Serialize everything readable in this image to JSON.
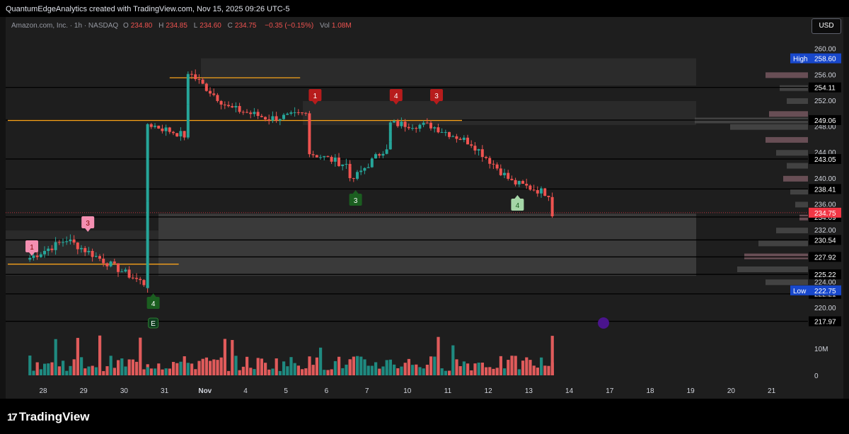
{
  "header": {
    "credit": "QuantumEdgeAnalytics created with TradingView.com, Nov 15, 2025 09:26 UTC-5"
  },
  "legend": {
    "symbol": "Amazon.com, Inc. · 1h · NASDAQ",
    "o_label": "O",
    "o_value": "234.80",
    "h_label": "H",
    "h_value": "234.85",
    "l_label": "L",
    "l_value": "234.60",
    "c_label": "C",
    "c_value": "234.75",
    "change": "−0.35 (−0.15%)",
    "vol_label": "Vol",
    "vol_value": "1.08M"
  },
  "currency_button": "USD",
  "colors": {
    "up": "#26a69a",
    "down": "#ef5350",
    "level": "#f7a21b",
    "low_label": "#1848cc",
    "price_label": "#f23645"
  },
  "badges": {
    "high_label": "High",
    "high_value": "258.60",
    "low_label": "Low",
    "low_value": "222.75",
    "last_price": "234.75"
  },
  "branding": {
    "name": "TradingView"
  },
  "chart_data": {
    "type": "candlestick",
    "y_axis": {
      "range": [
        216.5,
        261.5
      ],
      "ticks": [
        "260.00",
        "256.00",
        "252.00",
        "248.00",
        "244.00",
        "240.00",
        "236.00",
        "232.00",
        "228.00",
        "224.00",
        "220.00"
      ]
    },
    "volume_axis": {
      "ticks": [
        "10M",
        "0"
      ]
    },
    "x_axis": {
      "ticks": [
        "28",
        "29",
        "30",
        "31",
        "Nov",
        "4",
        "5",
        "6",
        "7",
        "10",
        "11",
        "12",
        "13",
        "14",
        "17",
        "18",
        "19",
        "20",
        "21"
      ]
    },
    "horizontal_levels": [
      "254.11",
      "249.06",
      "243.05",
      "238.41",
      "234.09",
      "230.54",
      "227.92",
      "225.22",
      "222.21",
      "217.97"
    ],
    "orange_levels": [
      {
        "price": 255.6,
        "from": "Nov",
        "to": "5"
      },
      {
        "price": 249.0,
        "from": "28",
        "to": "11"
      },
      {
        "price": 226.8,
        "from": "28",
        "to": "31"
      }
    ],
    "markers": [
      {
        "text": "1",
        "kind": "sell",
        "color": "#f48fb1",
        "date": "28"
      },
      {
        "text": "3",
        "kind": "sell",
        "color": "#f48fb1",
        "date": "29"
      },
      {
        "text": "4",
        "kind": "buy",
        "color": "#1b5e20",
        "date": "31"
      },
      {
        "text": "1",
        "kind": "sell",
        "color": "#b71c1c",
        "date": "6"
      },
      {
        "text": "3",
        "kind": "buy",
        "color": "#1b5e20",
        "date": "7"
      },
      {
        "text": "4",
        "kind": "sell",
        "color": "#b71c1c",
        "date": "10"
      },
      {
        "text": "3",
        "kind": "sell",
        "color": "#b71c1c",
        "date": "11"
      },
      {
        "text": "4",
        "kind": "buy",
        "color": "#a5d6a7",
        "date": "13"
      },
      {
        "text": "E",
        "kind": "earnings",
        "color": "#1b5e20",
        "date": "31"
      }
    ],
    "price_path": [
      {
        "date": "28",
        "close": 227.5
      },
      {
        "date": "29",
        "close": 230.6
      },
      {
        "date": "30",
        "close": 227.0
      },
      {
        "date": "31",
        "close": 223.5
      },
      {
        "date": "31",
        "close": 248.5
      },
      {
        "date": "Nov",
        "close": 246.5
      },
      {
        "date": "Nov",
        "close": 256.5
      },
      {
        "date": "4",
        "close": 251.0
      },
      {
        "date": "5",
        "close": 249.3
      },
      {
        "date": "6",
        "close": 250.0
      },
      {
        "date": "6",
        "close": 244.0
      },
      {
        "date": "7",
        "close": 242.0
      },
      {
        "date": "7",
        "close": 239.5
      },
      {
        "date": "10",
        "close": 245.5
      },
      {
        "date": "10",
        "close": 248.5
      },
      {
        "date": "11",
        "close": 248.2
      },
      {
        "date": "12",
        "close": 245.5
      },
      {
        "date": "13",
        "close": 239.5
      },
      {
        "date": "14",
        "close": 237.5
      },
      {
        "date": "14",
        "close": 234.75
      }
    ],
    "grid": false
  }
}
